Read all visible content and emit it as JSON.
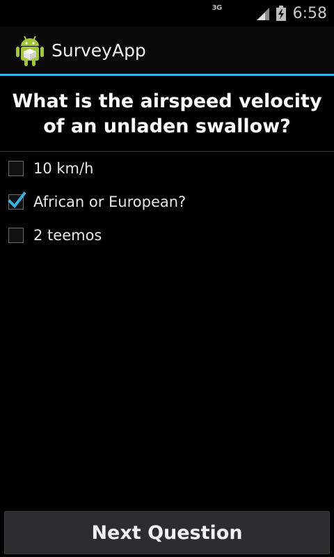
{
  "status_bar": {
    "network_type": "3G",
    "time": "6:58",
    "icons": [
      "signal-icon",
      "battery-icon"
    ]
  },
  "action_bar": {
    "app_icon": "android-robot-icon",
    "title": "SurveyApp",
    "accent_color": "#33b5e5"
  },
  "question": {
    "text": "What is the airspeed velocity of an unladen swallow?"
  },
  "options": [
    {
      "label": "10 km/h",
      "checked": false
    },
    {
      "label": "African or European?",
      "checked": true
    },
    {
      "label": "2 teemos",
      "checked": false
    }
  ],
  "footer": {
    "next_label": "Next Question"
  }
}
